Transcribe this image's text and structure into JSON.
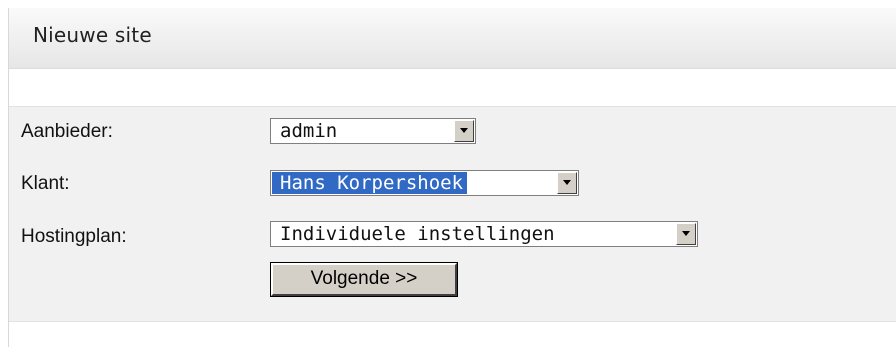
{
  "panel": {
    "title": "Nieuwe site"
  },
  "form": {
    "provider": {
      "label": "Aanbieder:",
      "value": "admin"
    },
    "customer": {
      "label": "Klant:",
      "value": "Hans Korpershoek"
    },
    "hosting_plan": {
      "label": "Hostingplan:",
      "value": "Individuele instellingen"
    },
    "next_button": "Volgende >>"
  },
  "colors": {
    "selection": "#316ac5",
    "form_background": "#f1f1f1"
  }
}
